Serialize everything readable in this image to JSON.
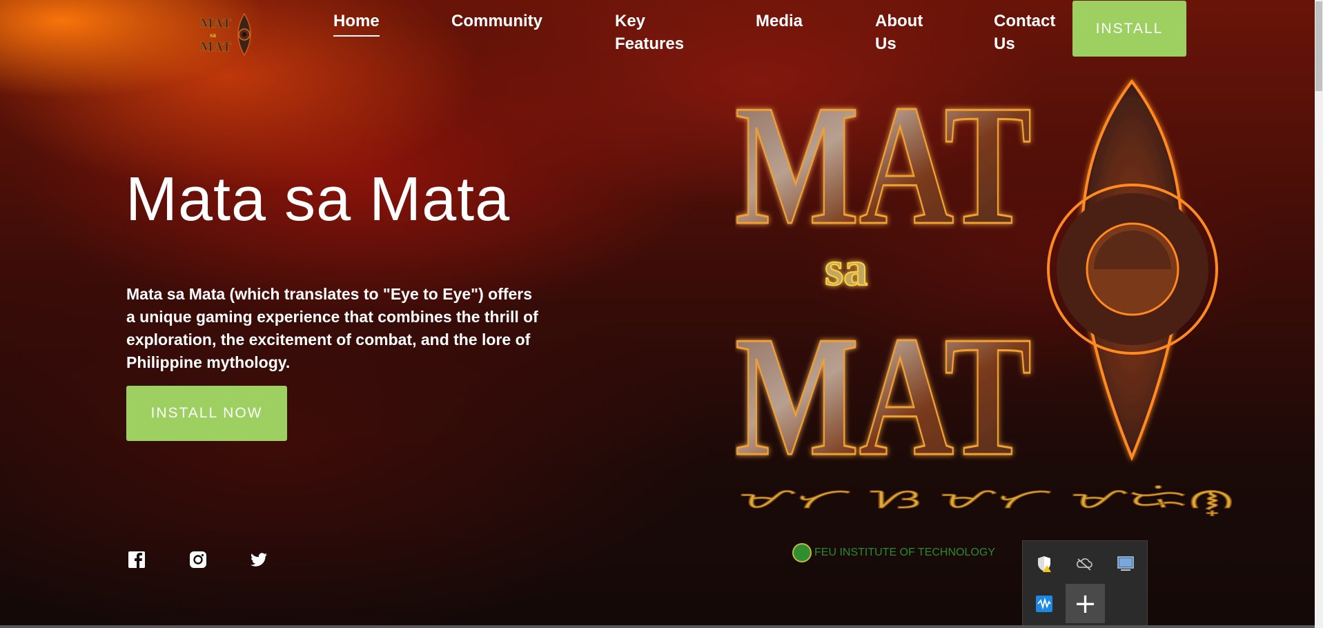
{
  "nav": {
    "logo_text_top": "MAT",
    "logo_text_mid": "sa",
    "logo_text_bottom": "MAT",
    "items": [
      {
        "label": "Home",
        "active": true
      },
      {
        "label": "Community"
      },
      {
        "label": "Key Features"
      },
      {
        "label": "Media"
      },
      {
        "label": "About Us"
      },
      {
        "label": "Contact Us"
      }
    ],
    "install_label": "INSTALL"
  },
  "hero": {
    "title": "Mata sa Mata",
    "description": "Mata sa Mata (which translates to \"Eye to Eye\") offers a unique gaming experience that combines the thrill of exploration, the excitement of combat, and the lore of Philippine mythology.",
    "cta_label": "INSTALL NOW"
  },
  "big_logo": {
    "line1": "MAT",
    "line2": "sa",
    "line3": "MAT",
    "script": "ᜋᜆ ᜐ ᜋᜆ ᜋᜍᜒᜈ᜔"
  },
  "social": [
    "facebook-icon",
    "instagram-icon",
    "twitter-icon"
  ],
  "footer": {
    "institution": "FEU INSTITUTE OF TECHNOLOGY"
  },
  "colors": {
    "accent_green": "#9dd060",
    "fire_orange": "#ff7a10",
    "deep_red": "#6a1408"
  }
}
